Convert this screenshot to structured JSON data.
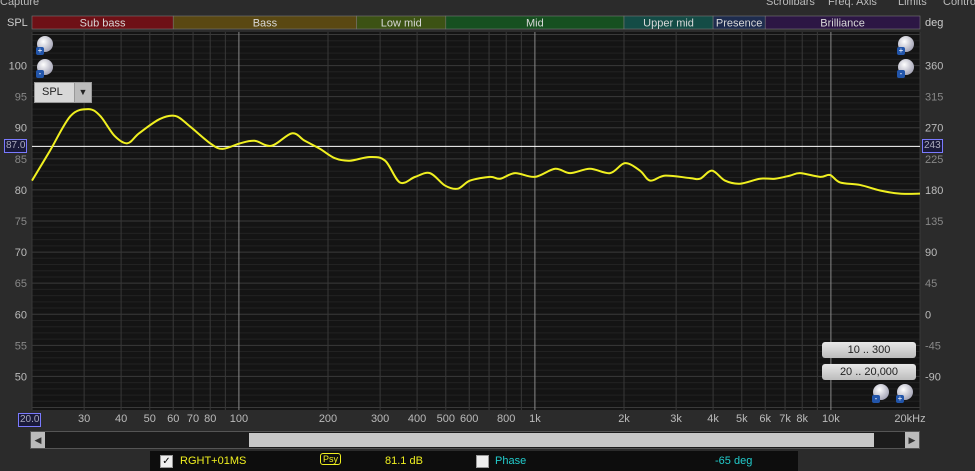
{
  "menu": {
    "capture": "Capture",
    "scrollbars": "Scrollbars",
    "freq_axis": "Freq. Axis",
    "limits": "Limits",
    "controls": "Controls"
  },
  "left_axis_label": "SPL",
  "right_axis_label": "deg",
  "spl_select": "SPL",
  "cursor_spl": "87.0",
  "cursor_phase": "243",
  "cursor_freq": "20.0",
  "range_buttons": [
    "10 .. 300",
    "20 .. 20,000"
  ],
  "legend": {
    "checked": true,
    "name": "RGHT+01MS",
    "psy": "Psy",
    "value": "81.1 dB",
    "phase_checked": false,
    "phase_label": "Phase",
    "phase_value": "-65 deg"
  },
  "colors": {
    "trace": "#f0f020",
    "cursor": "#ffffff"
  },
  "chart_data": {
    "type": "line",
    "xscale": "log",
    "xlim": [
      20,
      20000
    ],
    "ylim": [
      44.6,
      105.4
    ],
    "y_ticks": [
      100,
      95,
      90,
      85,
      80,
      75,
      70,
      65,
      60,
      55,
      50
    ],
    "phase_ticks": [
      360,
      315,
      270,
      225,
      180,
      135,
      90,
      45,
      0,
      -45,
      -90
    ],
    "phase_lim": [
      -90,
      360
    ],
    "x_ticks": [
      {
        "v": 30,
        "l": "30"
      },
      {
        "v": 40,
        "l": "40"
      },
      {
        "v": 50,
        "l": "50"
      },
      {
        "v": 60,
        "l": "60"
      },
      {
        "v": 70,
        "l": "70"
      },
      {
        "v": 80,
        "l": "80"
      },
      {
        "v": 100,
        "l": "100"
      },
      {
        "v": 200,
        "l": "200"
      },
      {
        "v": 300,
        "l": "300"
      },
      {
        "v": 400,
        "l": "400"
      },
      {
        "v": 500,
        "l": "500"
      },
      {
        "v": 600,
        "l": "600"
      },
      {
        "v": 800,
        "l": "800"
      },
      {
        "v": 1000,
        "l": "1k"
      },
      {
        "v": 2000,
        "l": "2k"
      },
      {
        "v": 3000,
        "l": "3k"
      },
      {
        "v": 4000,
        "l": "4k"
      },
      {
        "v": 5000,
        "l": "5k"
      },
      {
        "v": 6000,
        "l": "6k"
      },
      {
        "v": 7000,
        "l": "7k"
      },
      {
        "v": 8000,
        "l": "8k"
      },
      {
        "v": 10000,
        "l": "10k"
      },
      {
        "v": 20000,
        "l": "20kHz"
      }
    ],
    "bands": [
      {
        "name": "Sub bass",
        "from": 20,
        "to": 60,
        "color": "#6e1016"
      },
      {
        "name": "Bass",
        "from": 60,
        "to": 250,
        "color": "#5a4812"
      },
      {
        "name": "Low mid",
        "from": 250,
        "to": 500,
        "color": "#3c5214"
      },
      {
        "name": "Mid",
        "from": 500,
        "to": 2000,
        "color": "#165020"
      },
      {
        "name": "Upper mid",
        "from": 2000,
        "to": 4000,
        "color": "#144c46"
      },
      {
        "name": "Presence",
        "from": 4000,
        "to": 6000,
        "color": "#1e2c4e"
      },
      {
        "name": "Brilliance",
        "from": 6000,
        "to": 20000,
        "color": "#2c1644"
      }
    ],
    "series": [
      {
        "name": "RGHT+01MS",
        "x": [
          20,
          23,
          27,
          31,
          34,
          38,
          42,
          46,
          54,
          61,
          68,
          80,
          88,
          101,
          113,
          129,
          151,
          167,
          188,
          211,
          237,
          277,
          312,
          350,
          394,
          442,
          497,
          549,
          604,
          705,
          763,
          857,
          1000,
          1170,
          1315,
          1535,
          1795,
          2015,
          2265,
          2450,
          2755,
          3345,
          3615,
          3965,
          4385,
          4930,
          5760,
          6475,
          7275,
          7870,
          9190,
          9930,
          10740,
          12540,
          14660,
          17100,
          20000
        ],
        "y": [
          81.5,
          86.3,
          91.9,
          93.0,
          91.9,
          88.7,
          87.5,
          89.1,
          91.4,
          91.9,
          90.3,
          87.5,
          86.6,
          87.5,
          87.9,
          87.1,
          89.1,
          87.9,
          86.6,
          85.1,
          84.7,
          85.3,
          84.7,
          81.2,
          82.1,
          82.7,
          80.7,
          80.2,
          81.5,
          82.1,
          81.8,
          82.7,
          82.1,
          83.4,
          82.7,
          83.4,
          82.7,
          84.3,
          83.1,
          81.5,
          82.3,
          81.9,
          81.8,
          83.1,
          81.5,
          81.0,
          81.8,
          81.8,
          82.3,
          82.7,
          82.1,
          82.4,
          81.2,
          80.8,
          79.9,
          79.4,
          79.4
        ]
      }
    ],
    "cursor": {
      "spl": 87.0
    }
  }
}
